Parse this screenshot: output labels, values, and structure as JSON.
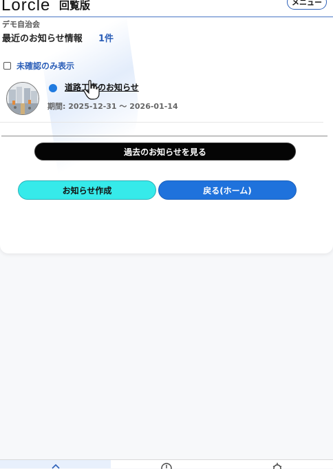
{
  "header": {
    "logo": "Lorcle",
    "logo_sub": "回覧版",
    "menu_label": "メニュー"
  },
  "content": {
    "org_name": "デモ自治会",
    "section_title": "最近のお知らせ情報",
    "count": "1件",
    "filter_label": "未確認のみ表示",
    "notices": [
      {
        "title": "道路工事のお知らせ",
        "period": "期間: 2025-12-31 〜 2026-01-14",
        "unread": true
      }
    ],
    "past_button": "過去のお知らせを見る",
    "create_button": "お知らせ作成",
    "home_button": "戻る(ホーム)"
  },
  "colors": {
    "accent": "#2c5fb8",
    "unread_dot": "#1f7ae0",
    "create_button": "#36eaea",
    "home_button": "#1f72dc",
    "past_button": "#050505"
  },
  "bottom_nav": {
    "tabs": [
      {
        "icon": "home-icon",
        "active": true
      },
      {
        "icon": "clock-icon",
        "active": false
      },
      {
        "icon": "gear-icon",
        "active": false
      }
    ]
  }
}
